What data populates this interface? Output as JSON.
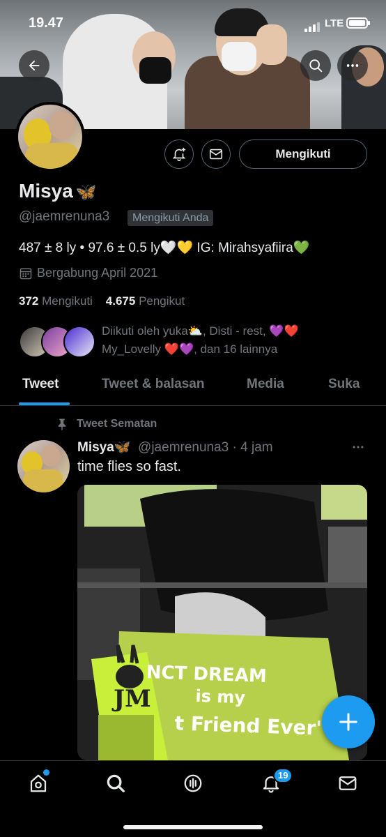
{
  "status_bar": {
    "time": "19.47",
    "network": "LTE"
  },
  "profile": {
    "name": "Misya",
    "name_emoji": "🦋",
    "handle": "@jaemrenuna3",
    "follows_you": "Mengikuti Anda",
    "follow_button": "Mengikuti",
    "bio": {
      "text": "487 ± 8 ly • 97.6 ± 0.5 ly",
      "heart_white": "🤍",
      "heart_yellow": "💛",
      "ig": " IG: Mirahsyafiira",
      "heart_green": "💚"
    },
    "joined": "Bergabung April 2021",
    "following_count": "372",
    "following_label": "Mengikuti",
    "followers_count": "4.675",
    "followers_label": "Pengikut",
    "followed_by": {
      "prefix": "Diikuti oleh yuka",
      "weather": "⛅",
      "mid": ", Disti - rest, ",
      "h1": "💜",
      "h2": "❤️",
      "line2_name": "My_Lovelly ",
      "h3": "❤️",
      "h4": "💜",
      "suffix": ", dan 16 lainnya"
    }
  },
  "tabs": [
    {
      "label": "Tweet"
    },
    {
      "label": "Tweet & balasan"
    },
    {
      "label": "Media"
    },
    {
      "label": "Suka"
    }
  ],
  "tweet": {
    "pinned_label": "Tweet Sematan",
    "author_name": "Misya",
    "author_emoji": "🦋",
    "author_handle": "@jaemrenuna3",
    "time": "· 4 jam",
    "text": "time flies so fast.",
    "image_text_line1": "NCT DREAM",
    "image_text_line2": "is my",
    "image_text_line3": "t Friend Ever'"
  },
  "nav": {
    "notification_count": "19"
  },
  "colors": {
    "accent": "#1d9bf0",
    "background": "#000000",
    "muted": "#71767b"
  }
}
